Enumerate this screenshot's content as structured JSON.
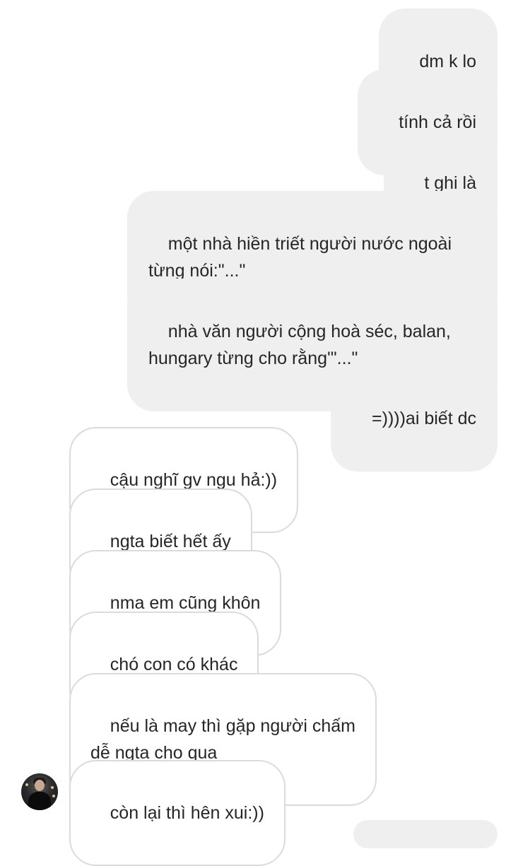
{
  "messages": [
    {
      "side": "sent",
      "text": "dm k lo"
    },
    {
      "side": "sent",
      "text": "tính cả rồi"
    },
    {
      "side": "sent",
      "text": "t ghi là"
    },
    {
      "side": "sent",
      "text": "một nhà hiền triết người nước ngoài\ntừng nói:\"...\""
    },
    {
      "side": "sent",
      "text": "nhà văn người cộng hoà séc, balan,\nhungary từng cho rằng'\"...\""
    },
    {
      "side": "sent",
      "text": "=))))ai biết dc"
    },
    {
      "side": "received",
      "text": "cậu nghĩ gv ngu hả:))"
    },
    {
      "side": "received",
      "text": "ngta biết hết ấy"
    },
    {
      "side": "received",
      "text": "nma em cũng khôn"
    },
    {
      "side": "received",
      "text": "chó con có khác"
    },
    {
      "side": "received",
      "text": "nếu là may thì gặp người chấm\ndễ ngta cho qua"
    },
    {
      "side": "received",
      "text": "còn lại thì hên xui:))"
    }
  ],
  "colors": {
    "sent_bubble": "#efefef",
    "received_border": "#dbdbdb",
    "text": "#262626"
  },
  "icons": {
    "avatar": "contact-avatar-photo"
  }
}
